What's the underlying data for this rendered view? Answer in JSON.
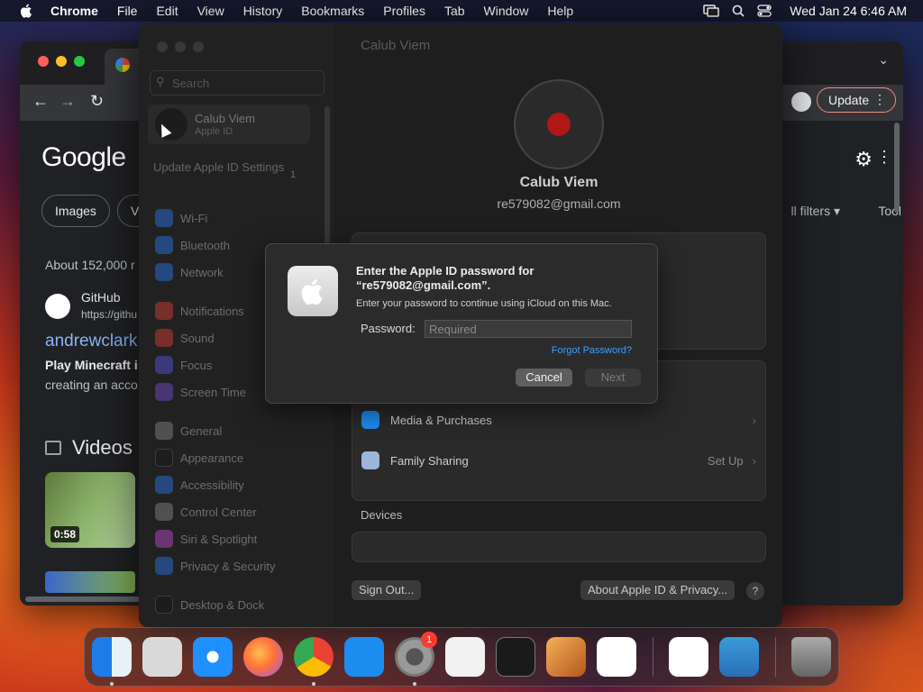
{
  "menubar": {
    "app_name": "Chrome",
    "items": [
      "File",
      "Edit",
      "View",
      "History",
      "Bookmarks",
      "Profiles",
      "Tab",
      "Window",
      "Help"
    ],
    "clock": "Wed Jan 24  6:46 AM"
  },
  "chrome": {
    "update_label": "Update",
    "google_word": "Google",
    "pills": [
      "Images",
      "Vi"
    ],
    "filters_label": "ll filters",
    "tools_label": "Tool",
    "stats": "About 152,000 r",
    "result": {
      "site": "GitHub",
      "url": "https://githu",
      "title": "andrewclark",
      "snippet_bold": "Play Minecraft i",
      "snippet": "creating an acco"
    },
    "videos_heading": "Videos",
    "video_duration": "0:58"
  },
  "sys": {
    "search_placeholder": "Search",
    "account": {
      "name": "Calub Viem",
      "subtitle": "Apple ID"
    },
    "update_text": "Update Apple ID Settings",
    "update_badge": "1",
    "sidebar_items": [
      {
        "label": "Wi-Fi",
        "color": "#2f7cf6"
      },
      {
        "label": "Bluetooth",
        "color": "#2f7cf6"
      },
      {
        "label": "Network",
        "color": "#2f7cf6"
      },
      {
        "label": "Notifications",
        "color": "#e5433b"
      },
      {
        "label": "Sound",
        "color": "#e5433b"
      },
      {
        "label": "Focus",
        "color": "#5e5ce6"
      },
      {
        "label": "Screen Time",
        "color": "#7c52d6"
      },
      {
        "label": "General",
        "color": "#8e8e93"
      },
      {
        "label": "Appearance",
        "color": "#1c1c1e"
      },
      {
        "label": "Accessibility",
        "color": "#2f7cf6"
      },
      {
        "label": "Control Center",
        "color": "#8e8e93"
      },
      {
        "label": "Siri & Spotlight",
        "color": "#c84fd8"
      },
      {
        "label": "Privacy & Security",
        "color": "#2f7cf6"
      },
      {
        "label": "Desktop & Dock",
        "color": "#1c1c1e"
      }
    ],
    "main_title": "Calub Viem",
    "user_name": "Calub Viem",
    "user_email": "re579082@gmail.com",
    "media_label": "Media & Purchases",
    "family_label": "Family Sharing",
    "family_value": "Set Up",
    "devices_heading": "Devices",
    "signout_label": "Sign Out...",
    "about_label": "About Apple ID & Privacy...",
    "help_label": "?"
  },
  "dialog": {
    "title": "Enter the Apple ID password for “re579082@gmail.com”.",
    "subtitle": "Enter your password to continue using iCloud on this Mac.",
    "password_label": "Password:",
    "password_placeholder": "Required",
    "forgot_label": "Forgot Password?",
    "cancel_label": "Cancel",
    "next_label": "Next"
  },
  "dock": {
    "apps": [
      {
        "name": "finder-icon",
        "color": "#2d8cf0"
      },
      {
        "name": "launchpad-icon",
        "color": "#d9d9d9"
      },
      {
        "name": "safari-icon",
        "color": "#1e90ff"
      },
      {
        "name": "firefox-icon",
        "color": "#ff7139"
      },
      {
        "name": "chrome-icon",
        "color": "#34a853"
      },
      {
        "name": "app-store-icon",
        "color": "#1c8cf0"
      },
      {
        "name": "system-settings-icon",
        "color": "#8e8e93"
      },
      {
        "name": "textedit-icon",
        "color": "#f2f2f2"
      },
      {
        "name": "terminal-icon",
        "color": "#1a1a1a"
      },
      {
        "name": "garageband-icon",
        "color": "#f08a24"
      },
      {
        "name": "vscode-icon",
        "color": "#ffffff"
      },
      {
        "name": "visual-studio-icon",
        "color": "#ffffff"
      },
      {
        "name": "weather-icon",
        "color": "#3a9ad9"
      },
      {
        "name": "trash-icon",
        "color": "#777777"
      }
    ],
    "settings_badge": "1"
  }
}
